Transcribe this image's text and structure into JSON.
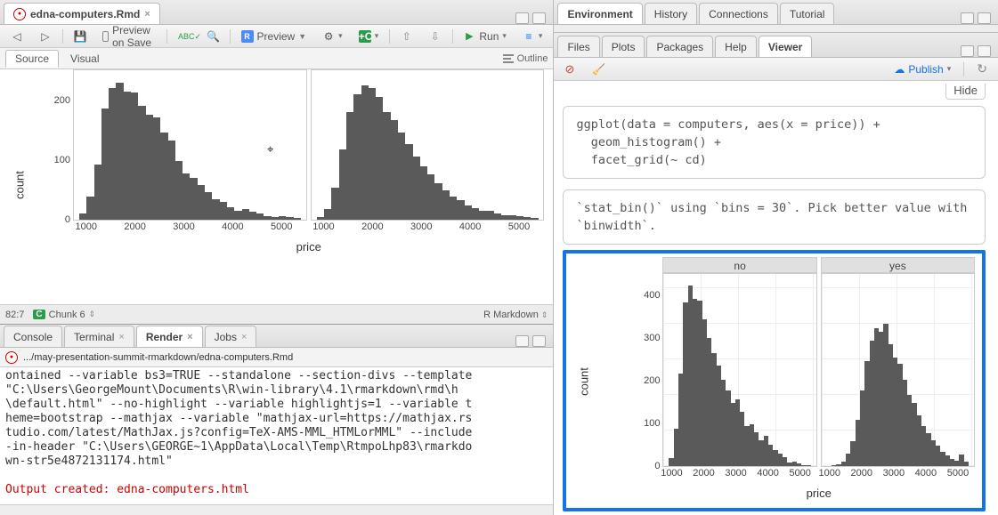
{
  "source_pane": {
    "file_tab": "edna-computers.Rmd",
    "toolbar": {
      "preview_on_save": "Preview on Save",
      "knit_btn": "Preview",
      "run_btn": "Run"
    },
    "mode_tabs": {
      "source": "Source",
      "visual": "Visual",
      "outline": "Outline"
    },
    "status": {
      "pos": "82:7",
      "chunk": "Chunk 6",
      "lang": "R Markdown"
    }
  },
  "console_pane": {
    "tabs": {
      "console": "Console",
      "terminal": "Terminal",
      "render": "Render",
      "jobs": "Jobs"
    },
    "path": ".../may-presentation-summit-rmarkdown/edna-computers.Rmd",
    "body_lines": [
      "ontained --variable bs3=TRUE --standalone --section-divs --template ",
      "\"C:\\Users\\GeorgeMount\\Documents\\R\\win-library\\4.1\\rmarkdown\\rmd\\h",
      "\\default.html\" --no-highlight --variable highlightjs=1 --variable t",
      "heme=bootstrap --mathjax --variable \"mathjax-url=https://mathjax.rs",
      "tudio.com/latest/MathJax.js?config=TeX-AMS-MML_HTMLorMML\" --include",
      "-in-header \"C:\\Users\\GEORGE~1\\AppData\\Local\\Temp\\RtmpoLhp83\\rmarkdo",
      "wn-str5e4872131174.html\""
    ],
    "output_msg": "Output created: edna-computers.html"
  },
  "env_pane": {
    "tabs": {
      "environment": "Environment",
      "history": "History",
      "connections": "Connections",
      "tutorial": "Tutorial"
    }
  },
  "viewer_pane": {
    "tabs": {
      "files": "Files",
      "plots": "Plots",
      "packages": "Packages",
      "help": "Help",
      "viewer": "Viewer"
    },
    "publish": "Publish",
    "hide": "Hide",
    "code": "ggplot(data = computers, aes(x = price)) +\n  geom_histogram() +\n  facet_grid(~ cd)",
    "message": "`stat_bin()` using `bins = 30`. Pick better value with\n`binwidth`."
  },
  "chart_data": [
    {
      "location": "source-pane",
      "type": "bar",
      "xlabel": "price",
      "ylabel": "count",
      "xlim": [
        750,
        5500
      ],
      "ylim": [
        0,
        250
      ],
      "xticks": [
        1000,
        2000,
        3000,
        4000,
        5000
      ],
      "yticks": [
        0,
        100,
        200
      ],
      "facets": [
        "left",
        "right"
      ],
      "series": [
        {
          "name": "left",
          "values": [
            10,
            40,
            95,
            190,
            225,
            235,
            220,
            218,
            195,
            180,
            175,
            150,
            135,
            100,
            80,
            72,
            60,
            48,
            35,
            30,
            22,
            15,
            18,
            14,
            10,
            6,
            5,
            6,
            5,
            3
          ]
        },
        {
          "name": "right",
          "values": [
            5,
            18,
            55,
            120,
            185,
            215,
            230,
            225,
            210,
            185,
            170,
            150,
            130,
            108,
            92,
            78,
            62,
            50,
            40,
            33,
            25,
            20,
            16,
            15,
            11,
            8,
            7,
            6,
            5,
            3
          ]
        }
      ]
    },
    {
      "location": "viewer-pane",
      "type": "bar",
      "xlabel": "price",
      "ylabel": "count",
      "xlim": [
        750,
        5500
      ],
      "ylim": [
        0,
        450
      ],
      "xticks": [
        1000,
        2000,
        3000,
        4000,
        5000
      ],
      "yticks": [
        0,
        100,
        200,
        300,
        400
      ],
      "facets": [
        "no",
        "yes"
      ],
      "series": [
        {
          "name": "no",
          "values": [
            20,
            90,
            220,
            390,
            430,
            400,
            395,
            350,
            305,
            270,
            240,
            205,
            180,
            150,
            160,
            130,
            95,
            100,
            80,
            62,
            72,
            50,
            38,
            30,
            22,
            8,
            10,
            6,
            2,
            2
          ]
        },
        {
          "name": "yes",
          "values": [
            0,
            2,
            4,
            10,
            30,
            60,
            110,
            180,
            250,
            300,
            330,
            320,
            340,
            290,
            260,
            245,
            205,
            170,
            150,
            120,
            95,
            78,
            62,
            48,
            35,
            25,
            18,
            12,
            28,
            10
          ]
        }
      ]
    }
  ]
}
